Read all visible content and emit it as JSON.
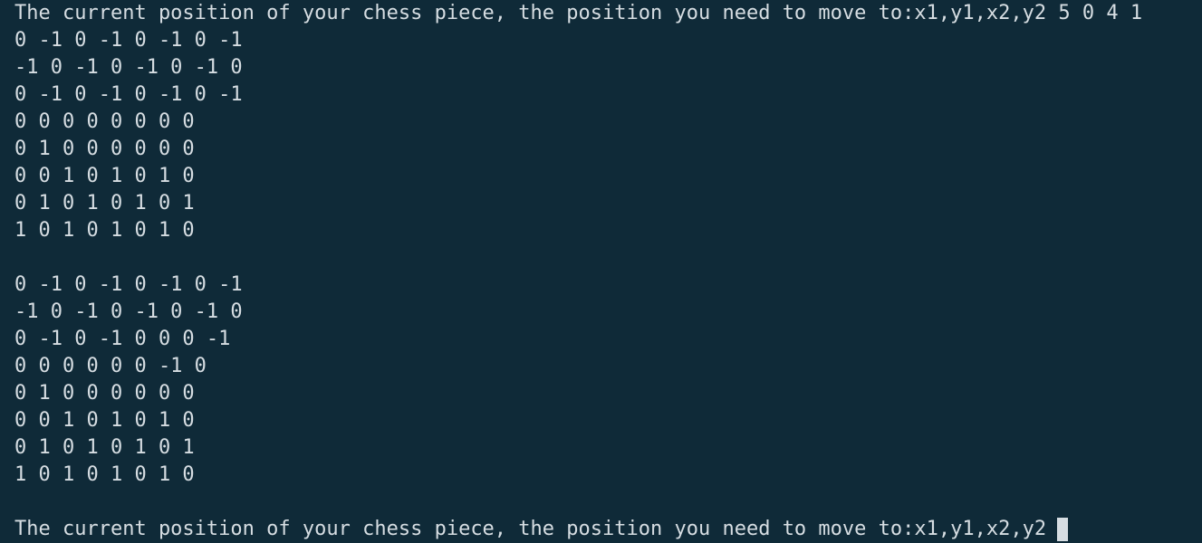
{
  "terminal": {
    "prompt_text": "The current position of your chess piece, the position you need to move to:x1,y1,x2,y2",
    "first_input": "5 0 4 1",
    "board_before": [
      "0 -1 0 -1 0 -1 0 -1",
      "-1 0 -1 0 -1 0 -1 0",
      "0 -1 0 -1 0 -1 0 -1",
      "0 0 0 0 0 0 0 0",
      "0 1 0 0 0 0 0 0",
      "0 0 1 0 1 0 1 0",
      "0 1 0 1 0 1 0 1",
      "1 0 1 0 1 0 1 0"
    ],
    "board_after": [
      "0 -1 0 -1 0 -1 0 -1",
      "-1 0 -1 0 -1 0 -1 0",
      "0 -1 0 -1 0 0 0 -1",
      "0 0 0 0 0 0 -1 0",
      "0 1 0 0 0 0 0 0",
      "0 0 1 0 1 0 1 0",
      "0 1 0 1 0 1 0 1",
      "1 0 1 0 1 0 1 0"
    ],
    "colors": {
      "background": "#0f2a38",
      "text": "#d6dde2",
      "cursor": "#d6dde2"
    }
  }
}
